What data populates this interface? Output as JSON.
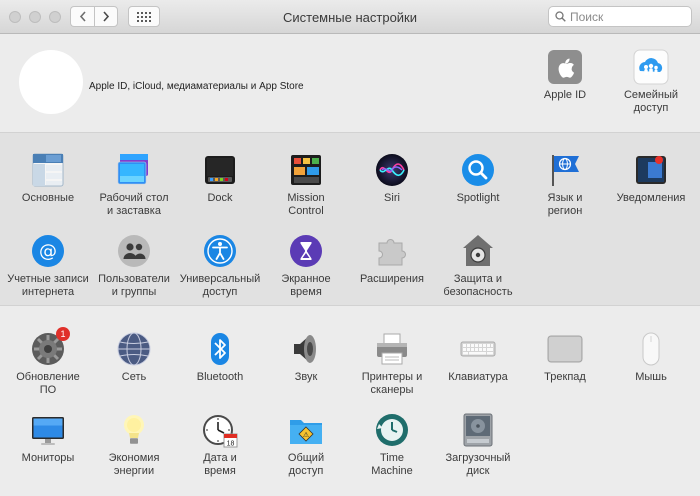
{
  "window": {
    "title": "Системные настройки",
    "search_placeholder": "Поиск"
  },
  "account": {
    "description": "Apple ID, iCloud, медиаматериалы и App Store",
    "items": [
      {
        "label": "Apple ID",
        "icon": "apple-id-icon"
      },
      {
        "label": "Семейный\nдоступ",
        "icon": "family-sharing-icon"
      }
    ]
  },
  "row1": [
    {
      "label": "Основные",
      "icon": "general-icon"
    },
    {
      "label": "Рабочий стол\nи заставка",
      "icon": "desktop-screensaver-icon"
    },
    {
      "label": "Dock",
      "icon": "dock-icon"
    },
    {
      "label": "Mission\nControl",
      "icon": "mission-control-icon"
    },
    {
      "label": "Siri",
      "icon": "siri-icon"
    },
    {
      "label": "Spotlight",
      "icon": "spotlight-icon"
    },
    {
      "label": "Язык и\nрегион",
      "icon": "language-region-icon"
    },
    {
      "label": "Уведомления",
      "icon": "notifications-icon"
    }
  ],
  "row2": [
    {
      "label": "Учетные записи\nинтернета",
      "icon": "internet-accounts-icon"
    },
    {
      "label": "Пользователи\nи группы",
      "icon": "users-groups-icon"
    },
    {
      "label": "Универсальный\nдоступ",
      "icon": "accessibility-icon"
    },
    {
      "label": "Экранное\nвремя",
      "icon": "screen-time-icon"
    },
    {
      "label": "Расширения",
      "icon": "extensions-icon"
    },
    {
      "label": "Защита и\nбезопасность",
      "icon": "security-privacy-icon"
    }
  ],
  "row3": [
    {
      "label": "Обновление\nПО",
      "icon": "software-update-icon",
      "badge": "1"
    },
    {
      "label": "Сеть",
      "icon": "network-icon"
    },
    {
      "label": "Bluetooth",
      "icon": "bluetooth-icon"
    },
    {
      "label": "Звук",
      "icon": "sound-icon"
    },
    {
      "label": "Принтеры и\nсканеры",
      "icon": "printers-scanners-icon"
    },
    {
      "label": "Клавиатура",
      "icon": "keyboard-icon"
    },
    {
      "label": "Трекпад",
      "icon": "trackpad-icon"
    },
    {
      "label": "Мышь",
      "icon": "mouse-icon"
    }
  ],
  "row4": [
    {
      "label": "Мониторы",
      "icon": "displays-icon"
    },
    {
      "label": "Экономия\nэнергии",
      "icon": "energy-saver-icon"
    },
    {
      "label": "Дата и\nвремя",
      "icon": "date-time-icon",
      "calendar_day": "18"
    },
    {
      "label": "Общий\nдоступ",
      "icon": "sharing-icon"
    },
    {
      "label": "Time\nMachine",
      "icon": "time-machine-icon"
    },
    {
      "label": "Загрузочный\nдиск",
      "icon": "startup-disk-icon"
    }
  ],
  "colors": {
    "close": "#d0d0d0",
    "badge": "#e0302a",
    "accent_blue": "#1a82e6"
  }
}
